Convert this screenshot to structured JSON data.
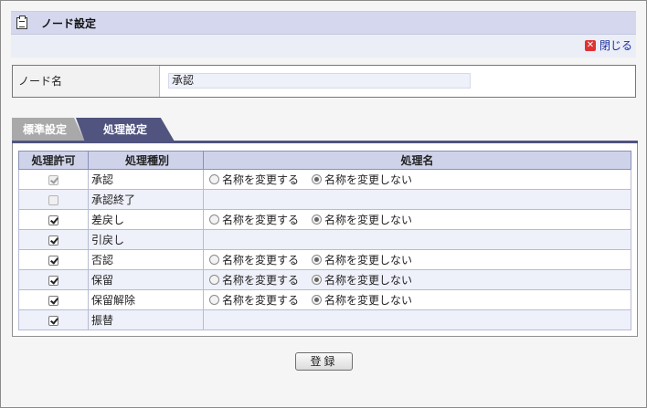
{
  "header": {
    "title": "ノード設定",
    "close_label": "閉じる"
  },
  "node": {
    "label": "ノード名",
    "value": "承認"
  },
  "tabs": [
    {
      "label": "標準設定",
      "active": false
    },
    {
      "label": "処理設定",
      "active": true
    }
  ],
  "table": {
    "columns": [
      "処理許可",
      "処理種別",
      "処理名"
    ],
    "rows": [
      {
        "permitted": true,
        "disabled": true,
        "kind": "承認",
        "has_options": true,
        "selected": "no_change"
      },
      {
        "permitted": false,
        "disabled": true,
        "kind": "承認終了",
        "has_options": false
      },
      {
        "permitted": true,
        "disabled": false,
        "kind": "差戻し",
        "has_options": true,
        "selected": "no_change"
      },
      {
        "permitted": true,
        "disabled": false,
        "kind": "引戻し",
        "has_options": false
      },
      {
        "permitted": true,
        "disabled": false,
        "kind": "否認",
        "has_options": true,
        "selected": "no_change"
      },
      {
        "permitted": true,
        "disabled": false,
        "kind": "保留",
        "has_options": true,
        "selected": "no_change"
      },
      {
        "permitted": true,
        "disabled": false,
        "kind": "保留解除",
        "has_options": true,
        "selected": "no_change"
      },
      {
        "permitted": true,
        "disabled": false,
        "kind": "振替",
        "has_options": false
      }
    ],
    "option_change": "名称を変更する",
    "option_keep": "名称を変更しない"
  },
  "footer": {
    "register_label": "登録"
  },
  "colors": {
    "header_bg": "#d4d7ee",
    "tab_active": "#50547f",
    "tab_inactive": "#a9a9a9",
    "table_header": "#cfd3ea",
    "row_alt": "#eef0fa",
    "link": "#1a2f9c",
    "close_icon": "#dd3333"
  },
  "icons": {
    "title": "clipboard-icon",
    "close": "close-x-icon"
  }
}
